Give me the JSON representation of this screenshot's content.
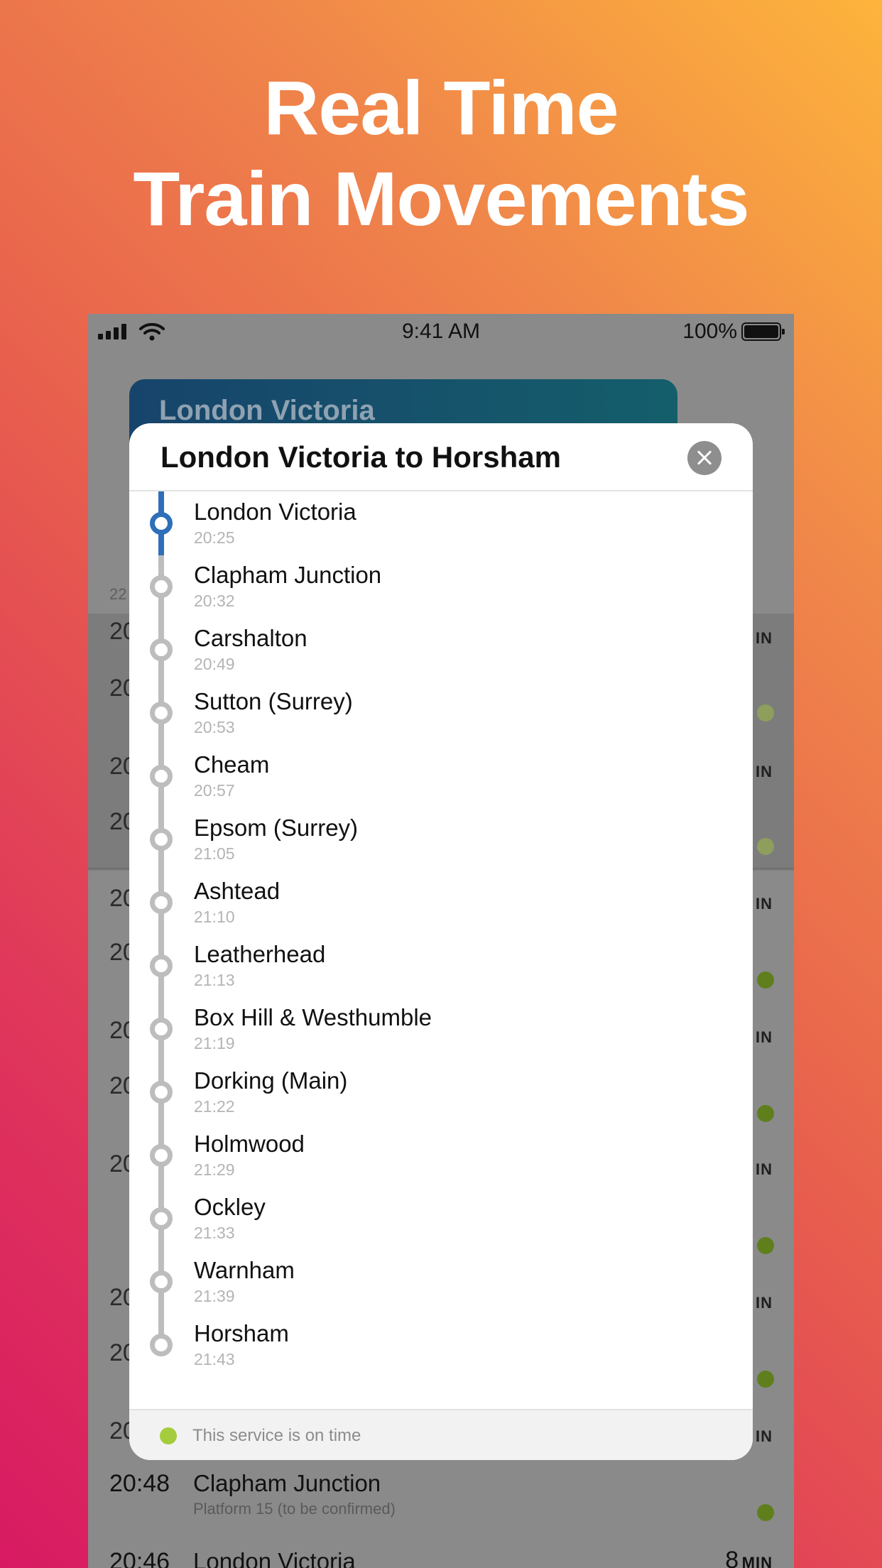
{
  "headline": {
    "line1": "Real Time",
    "line2": "Train Movements"
  },
  "status_bar": {
    "time": "9:41 AM",
    "battery": "100%"
  },
  "background": {
    "card_title": "London Victoria",
    "rows": [
      {
        "time": "22",
        "right": ""
      },
      {
        "time": "20",
        "right": "IN"
      },
      {
        "time": "20",
        "right": ""
      },
      {
        "time": "20",
        "right": "IN"
      },
      {
        "time": "20",
        "right": ""
      },
      {
        "time": "20",
        "right": "IN"
      },
      {
        "time": "20",
        "right": ""
      },
      {
        "time": "20",
        "right": "IN"
      },
      {
        "time": "20",
        "right": ""
      },
      {
        "time": "20",
        "right": "IN"
      },
      {
        "time": "20",
        "right": "IN"
      },
      {
        "time": "20",
        "right": ""
      },
      {
        "time": "20",
        "right": "IN"
      }
    ],
    "bottom_rows": [
      {
        "time": "20:48",
        "name": "Clapham Junction",
        "sub": "Platform 15 (to be confirmed)"
      },
      {
        "time": "20:46",
        "name": "London Victoria",
        "right_value": "8",
        "right_unit": "MIN"
      }
    ]
  },
  "modal": {
    "title": "London Victoria to Horsham",
    "stops": [
      {
        "name": "London Victoria",
        "time": "20:25",
        "current": true
      },
      {
        "name": "Clapham Junction",
        "time": "20:32"
      },
      {
        "name": "Carshalton",
        "time": "20:49"
      },
      {
        "name": "Sutton (Surrey)",
        "time": "20:53"
      },
      {
        "name": "Cheam",
        "time": "20:57"
      },
      {
        "name": "Epsom (Surrey)",
        "time": "21:05"
      },
      {
        "name": "Ashtead",
        "time": "21:10"
      },
      {
        "name": "Leatherhead",
        "time": "21:13"
      },
      {
        "name": "Box Hill & Westhumble",
        "time": "21:19"
      },
      {
        "name": "Dorking (Main)",
        "time": "21:22"
      },
      {
        "name": "Holmwood",
        "time": "21:29"
      },
      {
        "name": "Ockley",
        "time": "21:33"
      },
      {
        "name": "Warnham",
        "time": "21:39"
      },
      {
        "name": "Horsham",
        "time": "21:43"
      }
    ],
    "footer_status": "This service is on time",
    "colors": {
      "active_line": "#2d6fb8",
      "inactive_line": "#bdbdbd",
      "on_time_dot": "#a5cc3c"
    }
  }
}
